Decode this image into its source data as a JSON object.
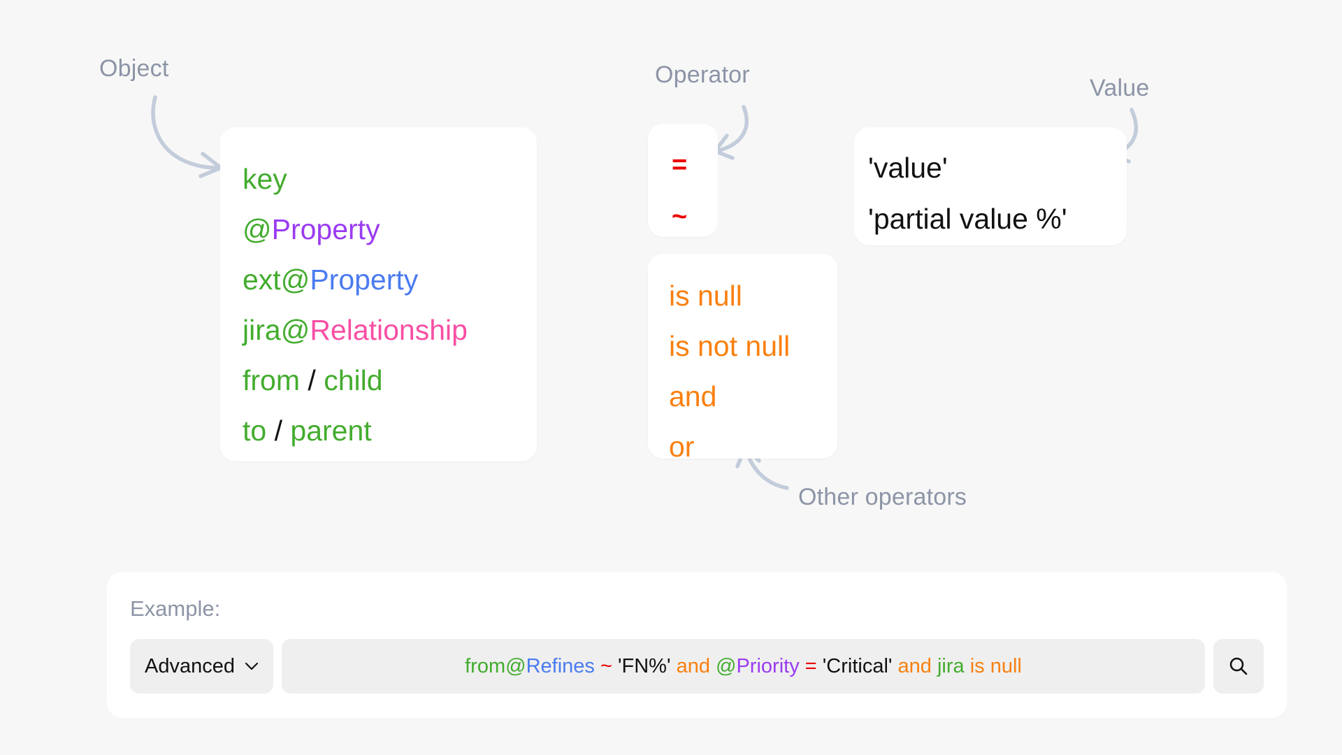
{
  "annotations": {
    "object": "Object",
    "operator": "Operator",
    "value": "Value",
    "other_operators": "Other operators"
  },
  "object_card": {
    "lines": [
      {
        "parts": [
          {
            "text": "key",
            "color": "green"
          }
        ]
      },
      {
        "parts": [
          {
            "text": "@",
            "color": "green"
          },
          {
            "text": "Property",
            "color": "purple"
          }
        ]
      },
      {
        "parts": [
          {
            "text": "ext",
            "color": "green"
          },
          {
            "text": "@",
            "color": "green"
          },
          {
            "text": "Property",
            "color": "blue"
          }
        ]
      },
      {
        "parts": [
          {
            "text": "jira",
            "color": "green"
          },
          {
            "text": "@",
            "color": "green"
          },
          {
            "text": "Relationship",
            "color": "pink"
          }
        ]
      },
      {
        "parts": [
          {
            "text": "from",
            "color": "green"
          },
          {
            "text": " / ",
            "color": "black"
          },
          {
            "text": "child",
            "color": "green"
          }
        ]
      },
      {
        "parts": [
          {
            "text": "to",
            "color": "green"
          },
          {
            "text": " / ",
            "color": "black"
          },
          {
            "text": "parent",
            "color": "green"
          }
        ]
      }
    ]
  },
  "operator_card": {
    "lines": [
      {
        "parts": [
          {
            "text": "=",
            "color": "red"
          }
        ]
      },
      {
        "parts": [
          {
            "text": "~",
            "color": "red"
          }
        ]
      }
    ]
  },
  "other_operators_card": {
    "lines": [
      {
        "parts": [
          {
            "text": "is null",
            "color": "orange"
          }
        ]
      },
      {
        "parts": [
          {
            "text": "is not null",
            "color": "orange"
          }
        ]
      },
      {
        "parts": [
          {
            "text": "and",
            "color": "orange"
          }
        ]
      },
      {
        "parts": [
          {
            "text": "or",
            "color": "orange"
          }
        ]
      }
    ]
  },
  "value_card": {
    "lines": [
      {
        "parts": [
          {
            "text": "'value'",
            "color": "black"
          }
        ]
      },
      {
        "parts": [
          {
            "text": "'partial value %'",
            "color": "black"
          }
        ]
      }
    ]
  },
  "example": {
    "title": "Example:",
    "mode_label": "Advanced",
    "mode_options": [
      "Advanced"
    ],
    "query_parts": [
      {
        "text": "from",
        "color": "green"
      },
      {
        "text": "@",
        "color": "green"
      },
      {
        "text": "Refines",
        "color": "blue"
      },
      {
        "text": " ",
        "color": "black"
      },
      {
        "text": "~",
        "color": "red"
      },
      {
        "text": " ",
        "color": "black"
      },
      {
        "text": "'FN%'",
        "color": "black"
      },
      {
        "text": " ",
        "color": "black"
      },
      {
        "text": "and",
        "color": "orange"
      },
      {
        "text": " ",
        "color": "black"
      },
      {
        "text": "@",
        "color": "green"
      },
      {
        "text": "Priority",
        "color": "purple"
      },
      {
        "text": " ",
        "color": "black"
      },
      {
        "text": "=",
        "color": "red"
      },
      {
        "text": " ",
        "color": "black"
      },
      {
        "text": "'Critical'",
        "color": "black"
      },
      {
        "text": " ",
        "color": "black"
      },
      {
        "text": "and",
        "color": "orange"
      },
      {
        "text": " ",
        "color": "black"
      },
      {
        "text": "jira",
        "color": "green"
      },
      {
        "text": " ",
        "color": "black"
      },
      {
        "text": "is null",
        "color": "orange"
      }
    ],
    "query_plain": "from@Refines ~ 'FN%' and @Priority = 'Critical' and jira is null",
    "search_icon": "search-icon"
  },
  "colors": {
    "background": "#f7f7f7",
    "card": "#ffffff",
    "annotation": "#8c94a6",
    "arrow": "#c3ccdb",
    "green": "#43ac2e",
    "purple": "#9b3bf0",
    "blue": "#4a7bf0",
    "pink": "#f74fa4",
    "red": "#ed0000",
    "orange": "#f98010",
    "black": "#111111",
    "field": "#efefef"
  }
}
